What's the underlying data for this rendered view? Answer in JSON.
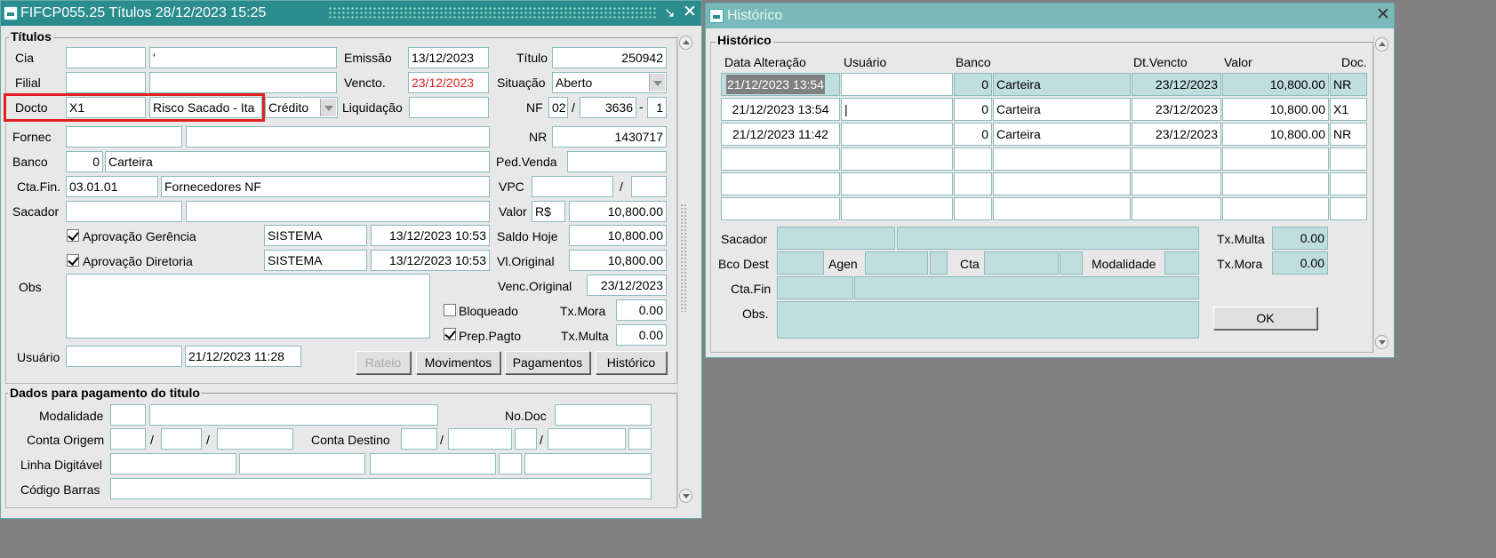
{
  "left_window": {
    "title": "FIFCP055.25    Títulos    28/12/2023 15:25",
    "group_titulos": "Títulos",
    "labels": {
      "cia": "Cia",
      "filial": "Filial",
      "docto": "Docto",
      "fornec": "Fornec",
      "banco": "Banco",
      "cta_fin": "Cta.Fin.",
      "sacador": "Sacador",
      "obs": "Obs",
      "usuario": "Usuário",
      "emissao": "Emissão",
      "vencto": "Vencto.",
      "liquidacao": "Liquidação",
      "titulo": "Título",
      "situacao": "Situação",
      "nf": "NF",
      "nr": "NR",
      "ped_venda": "Ped.Venda",
      "vpc": "VPC",
      "valor": "Valor",
      "saldo_hoje": "Saldo Hoje",
      "vl_original": "Vl.Original",
      "venc_original": "Venc.Original",
      "tx_mora": "Tx.Mora",
      "tx_multa": "Tx.Multa",
      "nf_sep1": "/",
      "nf_sep2": "-",
      "vpc_sep": "/"
    },
    "fields": {
      "cia_code": "",
      "cia_name": "'",
      "filial_code": "",
      "filial_name": "",
      "docto_code": "X1",
      "docto_desc": "Risco Sacado - Ita",
      "docto_type": "Crédito",
      "fornec_code": "",
      "fornec_name": "",
      "banco_code": "0",
      "banco_name": "Carteira",
      "cta_fin_code": "03.01.01",
      "cta_fin_name": "Fornecedores NF",
      "sacador_code": "",
      "sacador_name": "",
      "usuario_name": "",
      "usuario_date": "21/12/2023 11:28",
      "emissao": "13/12/2023",
      "vencto": "23/12/2023",
      "liquidacao": "",
      "titulo": "250942",
      "situacao": "Aberto",
      "nf_serie": "02",
      "nf_numero": "3636",
      "nf_parcela": "1",
      "nr": "1430717",
      "ped_venda": "",
      "vpc_1": "",
      "vpc_2": "",
      "valor_moeda": "R$",
      "valor": "10,800.00",
      "saldo_hoje": "10,800.00",
      "vl_original": "10,800.00",
      "venc_original": "23/12/2023",
      "tx_mora": "0.00",
      "tx_multa": "0.00",
      "obs": ""
    },
    "approvals": [
      {
        "label": "Aprovação Gerência",
        "user": "SISTEMA",
        "date": "13/12/2023 10:53",
        "checked": true
      },
      {
        "label": "Aprovação Diretoria",
        "user": "SISTEMA",
        "date": "13/12/2023 10:53",
        "checked": true
      }
    ],
    "checks": {
      "bloqueado": "Bloqueado",
      "prep_pagto": "Prep.Pagto"
    },
    "buttons": {
      "rateio": "Rateio",
      "movimentos": "Movimentos",
      "pagamentos": "Pagamentos",
      "historico": "Histórico"
    },
    "group_pagamento": "Dados para pagamento do titulo",
    "pag_labels": {
      "modalidade": "Modalidade",
      "no_doc": "No.Doc",
      "conta_origem": "Conta Origem",
      "conta_destino": "Conta Destino",
      "linha_digitavel": "Linha Digitável",
      "codigo_barras": "Código Barras",
      "sep": "/"
    }
  },
  "right_window": {
    "title": "Histórico",
    "group": "Histórico",
    "columns": [
      "Data Alteração",
      "Usuário",
      "Banco",
      "Dt.Vencto",
      "Valor",
      "Doc."
    ],
    "rows": [
      {
        "data": "21/12/2023 13:54",
        "usuario": "",
        "banco_cod": "0",
        "banco": "Carteira",
        "dt_vencto": "23/12/2023",
        "valor": "10,800.00",
        "doc": "NR"
      },
      {
        "data": "21/12/2023 13:54",
        "usuario": "|",
        "banco_cod": "0",
        "banco": "Carteira",
        "dt_vencto": "23/12/2023",
        "valor": "10,800.00",
        "doc": "X1"
      },
      {
        "data": "21/12/2023 11:42",
        "usuario": "",
        "banco_cod": "0",
        "banco": "Carteira",
        "dt_vencto": "23/12/2023",
        "valor": "10,800.00",
        "doc": "NR"
      }
    ],
    "labels": {
      "sacador": "Sacador",
      "bco_dest": "Bco Dest",
      "agen": "Agen",
      "cta": "Cta",
      "modalidade": "Modalidade",
      "cta_fin": "Cta.Fin",
      "obs": "Obs.",
      "tx_multa": "Tx.Multa",
      "tx_mora": "Tx.Mora"
    },
    "values": {
      "tx_multa": "0.00",
      "tx_mora": "0.00"
    },
    "ok_button": "OK"
  },
  "colors": {
    "titlebar": "#2a8c8c",
    "field_border": "#8cbcbc",
    "readonly_bg": "#c0dede",
    "highlight_box": "#e02020",
    "vencto_red": "#e02020"
  }
}
